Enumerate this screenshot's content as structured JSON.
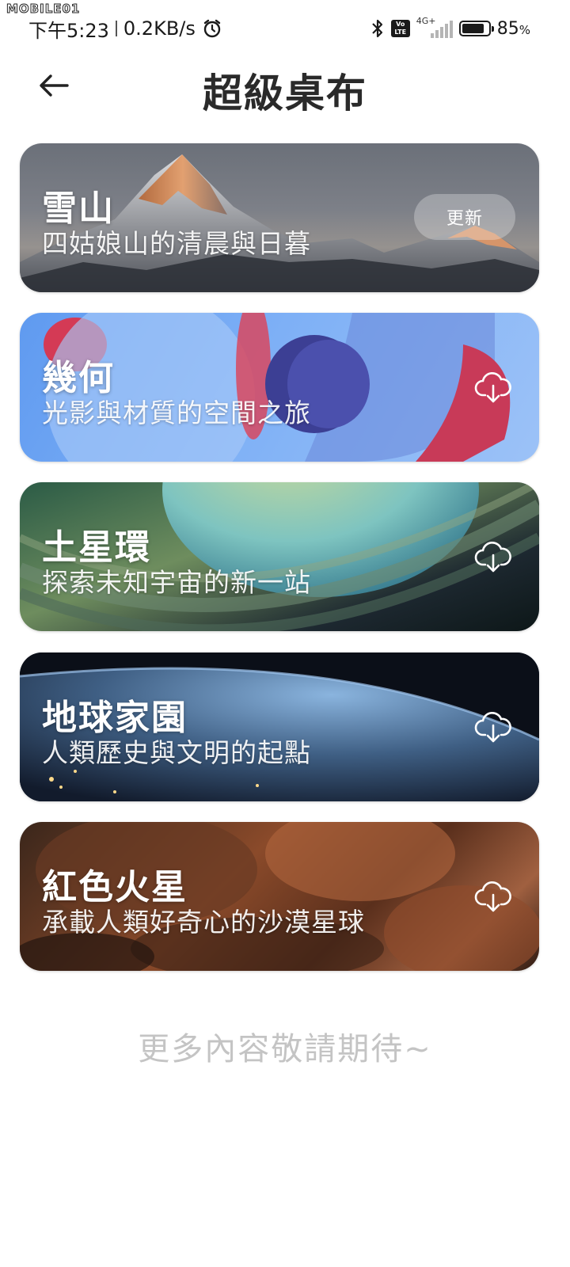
{
  "status_bar": {
    "watermark": "MOBILE01",
    "time": "下午5:23",
    "net_speed": "0.2KB/s",
    "volte_line1": "Vo",
    "volte_line2": "LTE",
    "network_type": "4G+",
    "battery_level": "85",
    "battery_unit": "%",
    "battery_fraction": 0.85,
    "icons": [
      "alarm-icon",
      "bluetooth-icon",
      "volte-icon",
      "signal-icon",
      "battery-icon"
    ]
  },
  "header": {
    "back_icon": "back-arrow-icon",
    "title": "超級桌布"
  },
  "wallpapers": [
    {
      "title": "雪山",
      "subtitle": "四姑娘山的清晨與日暮",
      "action": "更新",
      "action_type": "update"
    },
    {
      "title": "幾何",
      "subtitle": "光影與材質的空間之旅",
      "action_type": "download",
      "icon": "cloud-download-icon"
    },
    {
      "title": "土星環",
      "subtitle": "探索未知宇宙的新一站",
      "action_type": "download",
      "icon": "cloud-download-icon"
    },
    {
      "title": "地球家園",
      "subtitle": "人類歷史與文明的起點",
      "action_type": "download",
      "icon": "cloud-download-icon"
    },
    {
      "title": "紅色火星",
      "subtitle": "承載人類好奇心的沙漠星球",
      "action_type": "download",
      "icon": "cloud-download-icon"
    }
  ],
  "footer": {
    "text": "更多內容敬請期待~"
  },
  "colors": {
    "title_text": "#2a2a2a",
    "footer_text": "#c4c4c4",
    "background": "#ffffff"
  }
}
